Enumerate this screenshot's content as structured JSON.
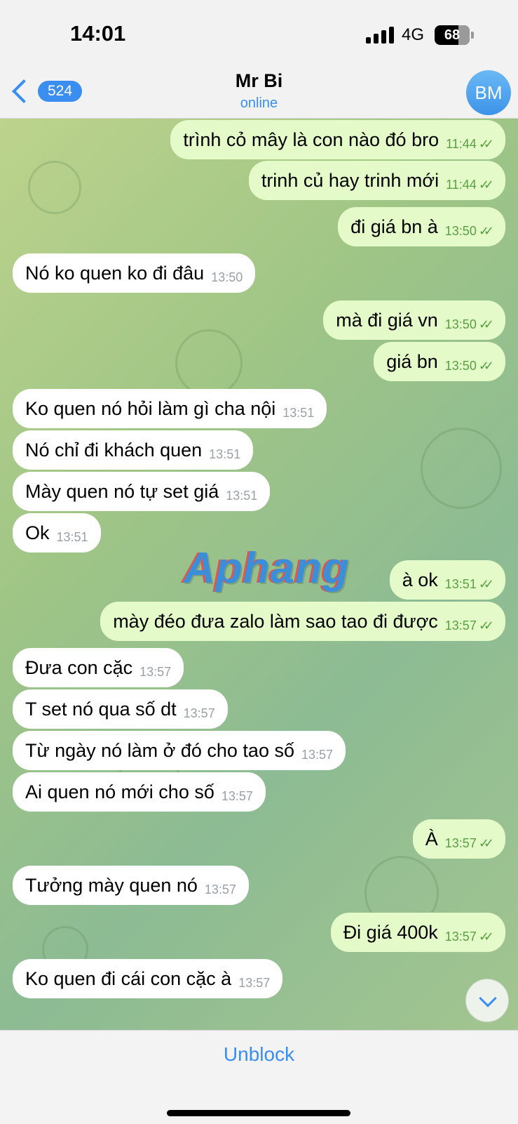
{
  "status_bar": {
    "time": "14:01",
    "network": "4G",
    "battery": "68"
  },
  "header": {
    "back_count": "524",
    "title": "Mr Bi",
    "status": "online",
    "avatar_initials": "BM"
  },
  "watermark": "Aphang",
  "messages": [
    {
      "dir": "out",
      "text": "trình cỏ mây là con nào đó bro",
      "time": "11:44",
      "read": true
    },
    {
      "dir": "out",
      "text": "trinh củ hay trinh mới",
      "time": "11:44",
      "read": true
    },
    {
      "dir": "out",
      "text": "đi giá bn à",
      "time": "13:50",
      "read": true
    },
    {
      "dir": "in",
      "text": "Nó ko quen ko đi đâu",
      "time": "13:50"
    },
    {
      "dir": "out",
      "text": "mà đi giá vn",
      "time": "13:50",
      "read": true
    },
    {
      "dir": "out",
      "text": "giá bn",
      "time": "13:50",
      "read": true
    },
    {
      "dir": "in",
      "text": "Ko quen nó hỏi làm gì cha nội",
      "time": "13:51"
    },
    {
      "dir": "in",
      "text": "Nó chỉ đi khách quen",
      "time": "13:51"
    },
    {
      "dir": "in",
      "text": "Mày quen nó tự set giá",
      "time": "13:51"
    },
    {
      "dir": "in",
      "text": "Ok",
      "time": "13:51"
    },
    {
      "dir": "out",
      "text": "à ok",
      "time": "13:51",
      "read": true
    },
    {
      "dir": "out",
      "text": "mày đéo đưa zalo làm sao tao đi được",
      "time": "13:57",
      "read": true
    },
    {
      "dir": "in",
      "text": "Đưa con cặc",
      "time": "13:57"
    },
    {
      "dir": "in",
      "text": "T set nó qua số dt",
      "time": "13:57"
    },
    {
      "dir": "in",
      "text": "Từ ngày nó làm ở đó cho tao số",
      "time": "13:57"
    },
    {
      "dir": "in",
      "text": "Ai quen nó mới cho số",
      "time": "13:57"
    },
    {
      "dir": "out",
      "text": "À",
      "time": "13:57",
      "read": true
    },
    {
      "dir": "in",
      "text": "Tưởng mày quen nó",
      "time": "13:57"
    },
    {
      "dir": "out",
      "text": "Đi giá 400k",
      "time": "13:57",
      "read": true
    },
    {
      "dir": "in",
      "text": "Ko quen đi cái con cặc à",
      "time": "13:57"
    }
  ],
  "bottom": {
    "action_label": "Unblock"
  },
  "colors": {
    "accent": "#3a8ef0",
    "outgoing_bubble": "#e4fbc9",
    "incoming_bubble": "#ffffff",
    "read_ticks": "#58a043"
  }
}
